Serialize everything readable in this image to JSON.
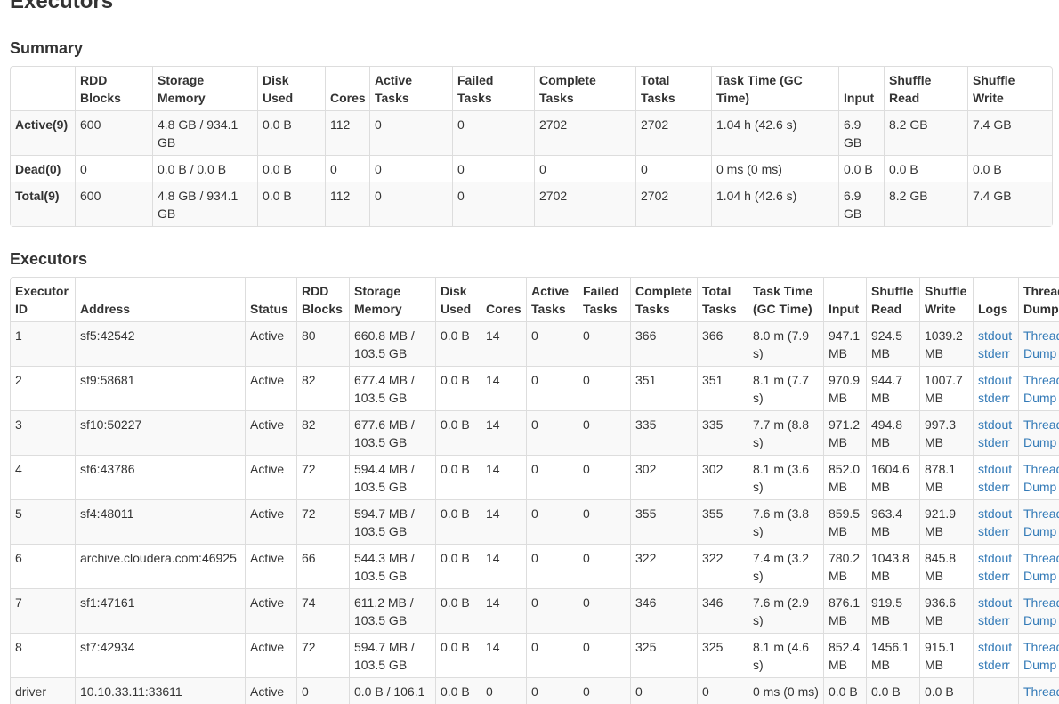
{
  "page_title": "Executors",
  "summary": {
    "heading": "Summary",
    "headers": [
      "",
      "RDD Blocks",
      "Storage Memory",
      "Disk Used",
      "Cores",
      "Active Tasks",
      "Failed Tasks",
      "Complete Tasks",
      "Total Tasks",
      "Task Time (GC Time)",
      "Input",
      "Shuffle Read",
      "Shuffle Write"
    ],
    "rows": [
      [
        "Active(9)",
        "600",
        "4.8 GB / 934.1 GB",
        "0.0 B",
        "112",
        "0",
        "0",
        "2702",
        "2702",
        "1.04 h (42.6 s)",
        "6.9 GB",
        "8.2 GB",
        "7.4 GB"
      ],
      [
        "Dead(0)",
        "0",
        "0.0 B / 0.0 B",
        "0.0 B",
        "0",
        "0",
        "0",
        "0",
        "0",
        "0 ms (0 ms)",
        "0.0 B",
        "0.0 B",
        "0.0 B"
      ],
      [
        "Total(9)",
        "600",
        "4.8 GB / 934.1 GB",
        "0.0 B",
        "112",
        "0",
        "0",
        "2702",
        "2702",
        "1.04 h (42.6 s)",
        "6.9 GB",
        "8.2 GB",
        "7.4 GB"
      ]
    ]
  },
  "executors": {
    "heading": "Executors",
    "headers": [
      "Executor ID",
      "Address",
      "Status",
      "RDD Blocks",
      "Storage Memory",
      "Disk Used",
      "Cores",
      "Active Tasks",
      "Failed Tasks",
      "Complete Tasks",
      "Total Tasks",
      "Task Time (GC Time)",
      "Input",
      "Shuffle Read",
      "Shuffle Write",
      "Logs",
      "Thread Dump"
    ],
    "links": {
      "stdout": "stdout",
      "stderr": "stderr",
      "thread_dump": "Thread Dump"
    },
    "rows": [
      [
        "1",
        "sf5:42542",
        "Active",
        "80",
        "660.8 MB / 103.5 GB",
        "0.0 B",
        "14",
        "0",
        "0",
        "366",
        "366",
        "8.0 m (7.9 s)",
        "947.1 MB",
        "924.5 MB",
        "1039.2 MB"
      ],
      [
        "2",
        "sf9:58681",
        "Active",
        "82",
        "677.4 MB / 103.5 GB",
        "0.0 B",
        "14",
        "0",
        "0",
        "351",
        "351",
        "8.1 m (7.7 s)",
        "970.9 MB",
        "944.7 MB",
        "1007.7 MB"
      ],
      [
        "3",
        "sf10:50227",
        "Active",
        "82",
        "677.6 MB / 103.5 GB",
        "0.0 B",
        "14",
        "0",
        "0",
        "335",
        "335",
        "7.7 m (8.8 s)",
        "971.2 MB",
        "494.8 MB",
        "997.3 MB"
      ],
      [
        "4",
        "sf6:43786",
        "Active",
        "72",
        "594.4 MB / 103.5 GB",
        "0.0 B",
        "14",
        "0",
        "0",
        "302",
        "302",
        "8.1 m (3.6 s)",
        "852.0 MB",
        "1604.6 MB",
        "878.1 MB"
      ],
      [
        "5",
        "sf4:48011",
        "Active",
        "72",
        "594.7 MB / 103.5 GB",
        "0.0 B",
        "14",
        "0",
        "0",
        "355",
        "355",
        "7.6 m (3.8 s)",
        "859.5 MB",
        "963.4 MB",
        "921.9 MB"
      ],
      [
        "6",
        "archive.cloudera.com:46925",
        "Active",
        "66",
        "544.3 MB / 103.5 GB",
        "0.0 B",
        "14",
        "0",
        "0",
        "322",
        "322",
        "7.4 m (3.2 s)",
        "780.2 MB",
        "1043.8 MB",
        "845.8 MB"
      ],
      [
        "7",
        "sf1:47161",
        "Active",
        "74",
        "611.2 MB / 103.5 GB",
        "0.0 B",
        "14",
        "0",
        "0",
        "346",
        "346",
        "7.6 m (2.9 s)",
        "876.1 MB",
        "919.5 MB",
        "936.6 MB"
      ],
      [
        "8",
        "sf7:42934",
        "Active",
        "72",
        "594.7 MB / 103.5 GB",
        "0.0 B",
        "14",
        "0",
        "0",
        "325",
        "325",
        "8.1 m (4.6 s)",
        "852.4 MB",
        "1456.1 MB",
        "915.1 MB"
      ],
      [
        "driver",
        "10.10.33.11:33611",
        "Active",
        "0",
        "0.0 B / 106.1 GB",
        "0.0 B",
        "0",
        "0",
        "0",
        "0",
        "0",
        "0 ms (0 ms)",
        "0.0 B",
        "0.0 B",
        "0.0 B"
      ]
    ],
    "row_has_logs": [
      true,
      true,
      true,
      true,
      true,
      true,
      true,
      true,
      false
    ]
  }
}
